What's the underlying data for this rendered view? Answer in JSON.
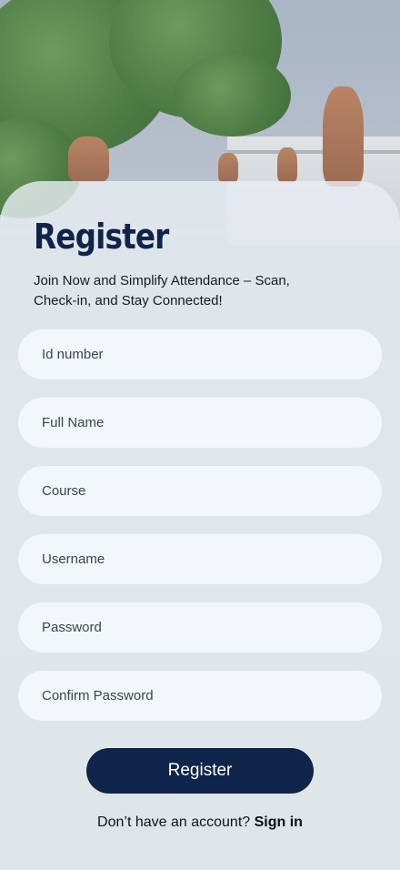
{
  "screen": {
    "title": "Register",
    "subtitle": "Join Now and Simplify Attendance – Scan, Check-in, and Stay Connected!"
  },
  "form": {
    "id_number_placeholder": "Id number",
    "full_name_placeholder": "Full Name",
    "course_placeholder": "Course",
    "username_placeholder": "Username",
    "password_placeholder": "Password",
    "confirm_password_placeholder": "Confirm Password",
    "submit_label": "Register"
  },
  "footer": {
    "prompt": "Don’t have an account?",
    "link_label": "Sign in"
  },
  "colors": {
    "primary": "#0f2449",
    "field_background": "#f2f7fa",
    "card_background": "#e7edf2"
  }
}
